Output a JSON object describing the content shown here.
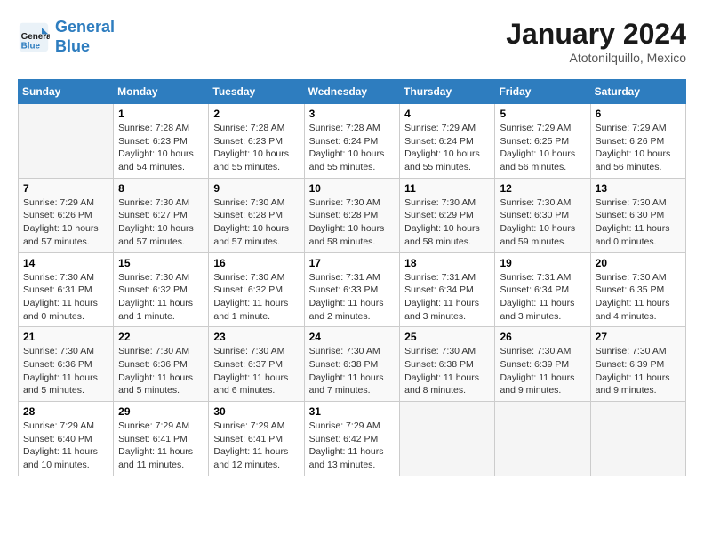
{
  "header": {
    "logo_line1": "General",
    "logo_line2": "Blue",
    "month": "January 2024",
    "location": "Atotonilquillo, Mexico"
  },
  "weekdays": [
    "Sunday",
    "Monday",
    "Tuesday",
    "Wednesday",
    "Thursday",
    "Friday",
    "Saturday"
  ],
  "weeks": [
    [
      {
        "day": "",
        "info": ""
      },
      {
        "day": "1",
        "info": "Sunrise: 7:28 AM\nSunset: 6:23 PM\nDaylight: 10 hours\nand 54 minutes."
      },
      {
        "day": "2",
        "info": "Sunrise: 7:28 AM\nSunset: 6:23 PM\nDaylight: 10 hours\nand 55 minutes."
      },
      {
        "day": "3",
        "info": "Sunrise: 7:28 AM\nSunset: 6:24 PM\nDaylight: 10 hours\nand 55 minutes."
      },
      {
        "day": "4",
        "info": "Sunrise: 7:29 AM\nSunset: 6:24 PM\nDaylight: 10 hours\nand 55 minutes."
      },
      {
        "day": "5",
        "info": "Sunrise: 7:29 AM\nSunset: 6:25 PM\nDaylight: 10 hours\nand 56 minutes."
      },
      {
        "day": "6",
        "info": "Sunrise: 7:29 AM\nSunset: 6:26 PM\nDaylight: 10 hours\nand 56 minutes."
      }
    ],
    [
      {
        "day": "7",
        "info": "Sunrise: 7:29 AM\nSunset: 6:26 PM\nDaylight: 10 hours\nand 57 minutes."
      },
      {
        "day": "8",
        "info": "Sunrise: 7:30 AM\nSunset: 6:27 PM\nDaylight: 10 hours\nand 57 minutes."
      },
      {
        "day": "9",
        "info": "Sunrise: 7:30 AM\nSunset: 6:28 PM\nDaylight: 10 hours\nand 57 minutes."
      },
      {
        "day": "10",
        "info": "Sunrise: 7:30 AM\nSunset: 6:28 PM\nDaylight: 10 hours\nand 58 minutes."
      },
      {
        "day": "11",
        "info": "Sunrise: 7:30 AM\nSunset: 6:29 PM\nDaylight: 10 hours\nand 58 minutes."
      },
      {
        "day": "12",
        "info": "Sunrise: 7:30 AM\nSunset: 6:30 PM\nDaylight: 10 hours\nand 59 minutes."
      },
      {
        "day": "13",
        "info": "Sunrise: 7:30 AM\nSunset: 6:30 PM\nDaylight: 11 hours\nand 0 minutes."
      }
    ],
    [
      {
        "day": "14",
        "info": "Sunrise: 7:30 AM\nSunset: 6:31 PM\nDaylight: 11 hours\nand 0 minutes."
      },
      {
        "day": "15",
        "info": "Sunrise: 7:30 AM\nSunset: 6:32 PM\nDaylight: 11 hours\nand 1 minute."
      },
      {
        "day": "16",
        "info": "Sunrise: 7:30 AM\nSunset: 6:32 PM\nDaylight: 11 hours\nand 1 minute."
      },
      {
        "day": "17",
        "info": "Sunrise: 7:31 AM\nSunset: 6:33 PM\nDaylight: 11 hours\nand 2 minutes."
      },
      {
        "day": "18",
        "info": "Sunrise: 7:31 AM\nSunset: 6:34 PM\nDaylight: 11 hours\nand 3 minutes."
      },
      {
        "day": "19",
        "info": "Sunrise: 7:31 AM\nSunset: 6:34 PM\nDaylight: 11 hours\nand 3 minutes."
      },
      {
        "day": "20",
        "info": "Sunrise: 7:30 AM\nSunset: 6:35 PM\nDaylight: 11 hours\nand 4 minutes."
      }
    ],
    [
      {
        "day": "21",
        "info": "Sunrise: 7:30 AM\nSunset: 6:36 PM\nDaylight: 11 hours\nand 5 minutes."
      },
      {
        "day": "22",
        "info": "Sunrise: 7:30 AM\nSunset: 6:36 PM\nDaylight: 11 hours\nand 5 minutes."
      },
      {
        "day": "23",
        "info": "Sunrise: 7:30 AM\nSunset: 6:37 PM\nDaylight: 11 hours\nand 6 minutes."
      },
      {
        "day": "24",
        "info": "Sunrise: 7:30 AM\nSunset: 6:38 PM\nDaylight: 11 hours\nand 7 minutes."
      },
      {
        "day": "25",
        "info": "Sunrise: 7:30 AM\nSunset: 6:38 PM\nDaylight: 11 hours\nand 8 minutes."
      },
      {
        "day": "26",
        "info": "Sunrise: 7:30 AM\nSunset: 6:39 PM\nDaylight: 11 hours\nand 9 minutes."
      },
      {
        "day": "27",
        "info": "Sunrise: 7:30 AM\nSunset: 6:39 PM\nDaylight: 11 hours\nand 9 minutes."
      }
    ],
    [
      {
        "day": "28",
        "info": "Sunrise: 7:29 AM\nSunset: 6:40 PM\nDaylight: 11 hours\nand 10 minutes."
      },
      {
        "day": "29",
        "info": "Sunrise: 7:29 AM\nSunset: 6:41 PM\nDaylight: 11 hours\nand 11 minutes."
      },
      {
        "day": "30",
        "info": "Sunrise: 7:29 AM\nSunset: 6:41 PM\nDaylight: 11 hours\nand 12 minutes."
      },
      {
        "day": "31",
        "info": "Sunrise: 7:29 AM\nSunset: 6:42 PM\nDaylight: 11 hours\nand 13 minutes."
      },
      {
        "day": "",
        "info": ""
      },
      {
        "day": "",
        "info": ""
      },
      {
        "day": "",
        "info": ""
      }
    ]
  ]
}
